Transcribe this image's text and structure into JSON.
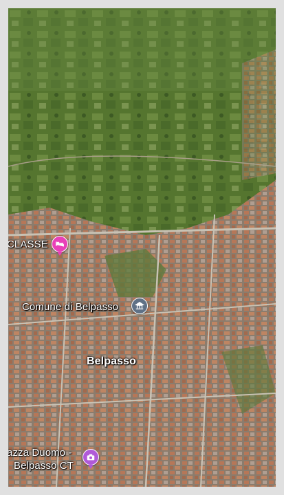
{
  "map": {
    "type": "satellite-3d",
    "colors": {
      "vegetation": "#5f7f3a",
      "urban_roofs": "#b5785a",
      "roads": "#c8c2b4"
    }
  },
  "places": [
    {
      "label": "CLASSE",
      "icon": "bed-icon",
      "color": "#e840b8"
    },
    {
      "label": "Comune di Belpasso",
      "icon": "government-building-icon",
      "color": "#5f7186"
    },
    {
      "label": "Belpasso",
      "icon": "",
      "color": ""
    },
    {
      "label_line1": "azza Duomo -",
      "label_line2": "Belpasso CT",
      "icon": "camera-icon",
      "color": "#b05ad8"
    }
  ]
}
